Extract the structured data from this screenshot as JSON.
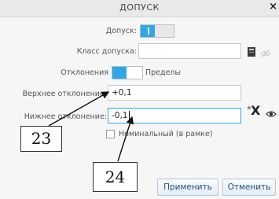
{
  "window": {
    "title": "ДОПУСК",
    "close_label": "×"
  },
  "form": {
    "tolerance_label": "Допуск:",
    "tolerance_class_label": "Класс допуска:",
    "tolerance_class_value": "",
    "mode_label_left": "Отклонения",
    "mode_label_right": "Пределы",
    "upper_label": "Верхнее отклонение:",
    "upper_value": "+0,1",
    "lower_label": "Нижнее отклонение:",
    "lower_value": "-0,1",
    "nominal_label": "Номинальный (в рамке)"
  },
  "icons": {
    "book": "book-icon",
    "eye_off": "eye-off-icon",
    "swap": "swap-x-icon",
    "eye": "eye-icon"
  },
  "callouts": {
    "a": "23",
    "b": "24"
  },
  "buttons": {
    "apply": "Применить",
    "cancel": "Отменить"
  },
  "colors": {
    "accent": "#2ea7e6",
    "button_text": "#2a4f7a"
  }
}
